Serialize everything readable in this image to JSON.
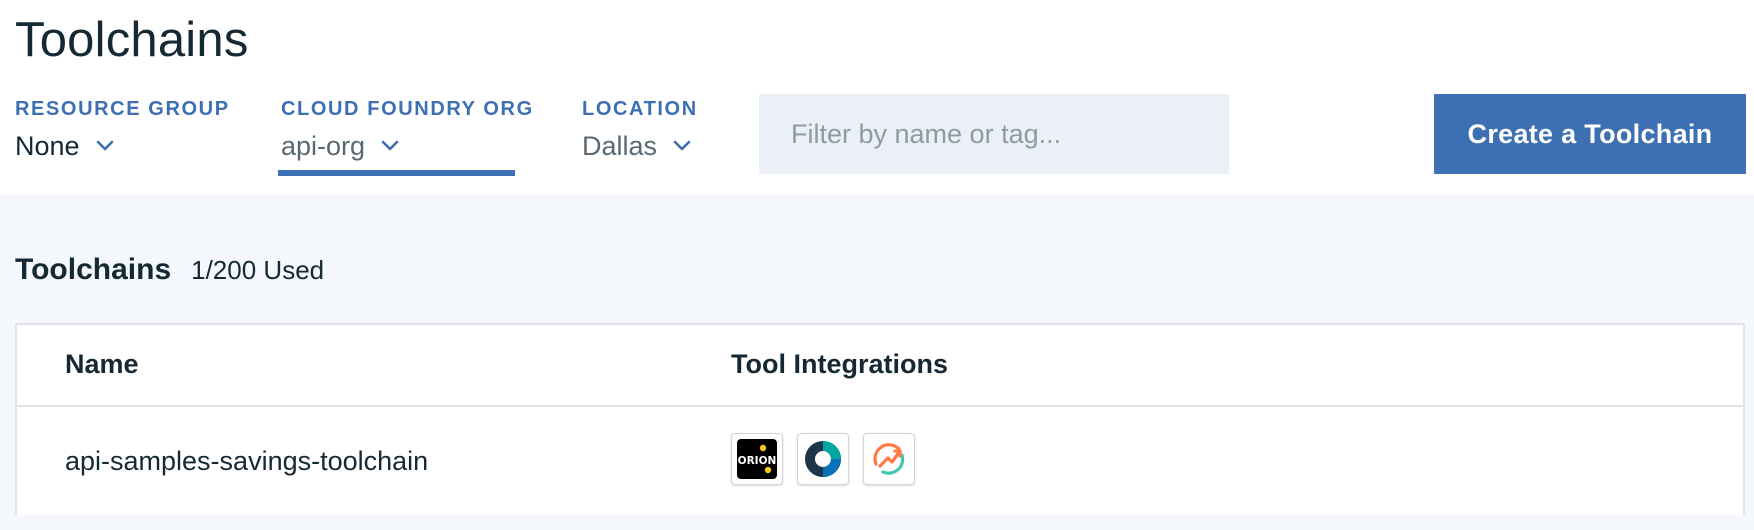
{
  "header": {
    "title": "Toolchains"
  },
  "filters": {
    "resource_group": {
      "label": "RESOURCE GROUP",
      "value": "None"
    },
    "cloud_foundry_org": {
      "label": "CLOUD FOUNDRY ORG",
      "value": "api-org"
    },
    "location": {
      "label": "LOCATION",
      "value": "Dallas"
    }
  },
  "search": {
    "placeholder": "Filter by name or tag..."
  },
  "actions": {
    "create_label": "Create a Toolchain"
  },
  "section": {
    "title": "Toolchains",
    "usage": "1/200 Used"
  },
  "table": {
    "columns": [
      "Name",
      "Tool Integrations"
    ],
    "rows": [
      {
        "name": "api-samples-savings-toolchain",
        "tools": [
          {
            "icon": "orion-web-ide-icon",
            "text": "ORION"
          },
          {
            "icon": "delivery-pipeline-icon"
          },
          {
            "icon": "devops-insights-icon"
          }
        ]
      }
    ]
  },
  "colors": {
    "accent": "#3d70b2",
    "text": "#152935",
    "section_bg": "#f4f7fb",
    "search_bg": "#ebf0f7",
    "border": "#dfe3e6"
  }
}
